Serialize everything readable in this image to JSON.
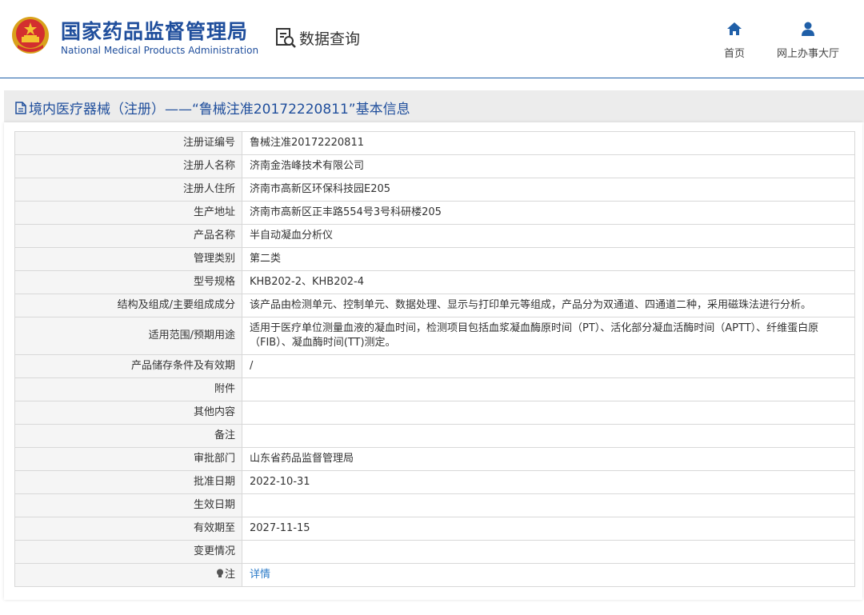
{
  "header": {
    "brand_cn": "国家药品监督管理局",
    "brand_en": "National Medical Products Administration",
    "query_label": "数据查询",
    "nav": {
      "home": "首页",
      "online_hall": "网上办事大厅"
    }
  },
  "section": {
    "title": "境内医疗器械（注册）——“鲁械注准20172220811”基本信息"
  },
  "rows": [
    {
      "label": "注册证编号",
      "value": "鲁械注准20172220811"
    },
    {
      "label": "注册人名称",
      "value": "济南金浩峰技术有限公司"
    },
    {
      "label": "注册人住所",
      "value": "济南市高新区环保科技园E205"
    },
    {
      "label": "生产地址",
      "value": "济南市高新区正丰路554号3号科研楼205"
    },
    {
      "label": "产品名称",
      "value": "半自动凝血分析仪"
    },
    {
      "label": "管理类别",
      "value": "第二类"
    },
    {
      "label": "型号规格",
      "value": "KHB202-2、KHB202-4"
    },
    {
      "label": "结构及组成/主要组成成分",
      "value": "该产品由检测单元、控制单元、数据处理、显示与打印单元等组成，产品分为双通道、四通道二种，采用磁珠法进行分析。"
    },
    {
      "label": "适用范围/预期用途",
      "value": "适用于医疗单位测量血液的凝血时间，检测项目包括血浆凝血酶原时间（PT）、活化部分凝血活酶时间（APTT）、纤维蛋白原（FIB）、凝血酶时间(TT)测定。"
    },
    {
      "label": "产品储存条件及有效期",
      "value": "/"
    },
    {
      "label": "附件",
      "value": ""
    },
    {
      "label": "其他内容",
      "value": ""
    },
    {
      "label": "备注",
      "value": ""
    },
    {
      "label": "审批部门",
      "value": "山东省药品监督管理局"
    },
    {
      "label": "批准日期",
      "value": "2022-10-31"
    },
    {
      "label": "生效日期",
      "value": ""
    },
    {
      "label": "有效期至",
      "value": "2027-11-15"
    },
    {
      "label": "变更情况",
      "value": ""
    },
    {
      "label": "注",
      "value": "详情"
    }
  ],
  "colors": {
    "brand_blue": "#1f4e9c",
    "link_blue": "#2a7ac8",
    "label_bg": "#f5f5f5"
  }
}
